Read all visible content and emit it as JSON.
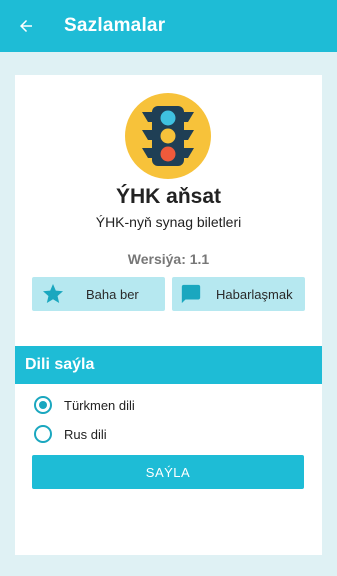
{
  "appbar": {
    "title": "Sazlamalar",
    "back_icon": "arrow-back-icon"
  },
  "about": {
    "app_name": "ÝHK aňsat",
    "subtitle": "ÝHK-nyň synag biletleri",
    "version": "Wersiýa: 1.1",
    "logo_icon": "traffic-light-icon"
  },
  "actions": {
    "rate": {
      "label": "Baha ber",
      "icon": "star-icon"
    },
    "contact": {
      "label": "Habarlaşmak",
      "icon": "chat-icon"
    }
  },
  "language": {
    "header": "Dili saýla",
    "options": [
      {
        "label": "Türkmen dili",
        "selected": true
      },
      {
        "label": "Rus dili",
        "selected": false
      }
    ],
    "save_label": "SAÝLA"
  },
  "colors": {
    "primary": "#1ebcd6",
    "button_light": "#b6e8f0",
    "background": "#dff1f4"
  }
}
